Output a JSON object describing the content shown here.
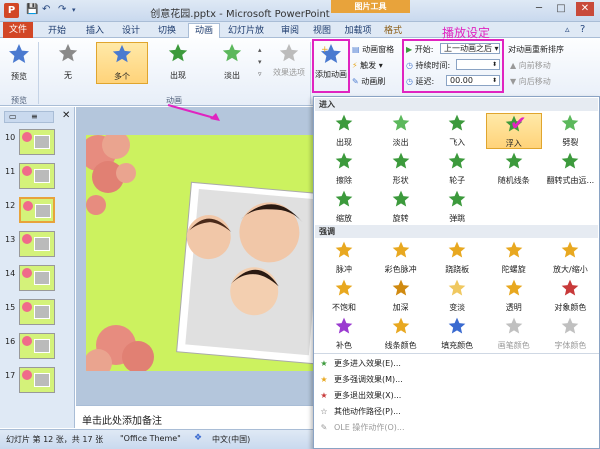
{
  "window": {
    "title": "创意花园.pptx - Microsoft PowerPoint",
    "context_tab_header": "图片工具",
    "app_icon": "P",
    "controls": [
      "─",
      "□",
      "✕"
    ]
  },
  "tabs": [
    {
      "label": "文件",
      "key": "file"
    },
    {
      "label": "开始"
    },
    {
      "label": "插入"
    },
    {
      "label": "设计"
    },
    {
      "label": "切换"
    },
    {
      "label": "动画",
      "key": "active"
    },
    {
      "label": "幻灯片放映"
    },
    {
      "label": "审阅"
    },
    {
      "label": "视图"
    },
    {
      "label": "加载项"
    },
    {
      "label": "格式"
    }
  ],
  "ribbon": {
    "preview_label": "预览",
    "preview_group": "预览",
    "animation_group": "动画",
    "gallery": [
      {
        "label": "无",
        "color": "#8a8a8a"
      },
      {
        "label": "多个",
        "color": "#4a7ad0",
        "selected": true
      },
      {
        "label": "出现",
        "color": "#3c9a3c"
      },
      {
        "label": "淡出",
        "color": "#5cb85c"
      }
    ],
    "effect_options": "效果选项",
    "add_animation": "添加动画",
    "animation_pane": "动画窗格",
    "trigger": "触发",
    "animation_painter": "动画刷",
    "start_label": "开始:",
    "start_value": "上一动画之后",
    "duration_label": "持续时间:",
    "duration_value": "",
    "delay_label": "延迟:",
    "delay_value": "00.00",
    "reorder_title": "对动画重新排序",
    "move_earlier": "向前移动",
    "move_later": "向后移动",
    "annotation": "播放设定"
  },
  "slides_pane": {
    "numbers": [
      "10",
      "11",
      "12",
      "13",
      "14",
      "15",
      "16",
      "17"
    ],
    "selected": "12"
  },
  "notes_placeholder": "单击此处添加备注",
  "status": {
    "slide_info": "幻灯片 第 12 张，共 17 张",
    "theme": "\"Office Theme\"",
    "language": "中文(中国)"
  },
  "dropdown": {
    "entrance_header": "进入",
    "emphasis_header": "强调",
    "entrance": [
      {
        "label": "出现",
        "color": "#3c9a3c"
      },
      {
        "label": "淡出",
        "color": "#5cb85c"
      },
      {
        "label": "飞入",
        "color": "#3c9a3c"
      },
      {
        "label": "浮入",
        "color": "#3c9a3c",
        "selected": true
      },
      {
        "label": "劈裂",
        "color": "#5cb85c"
      },
      {
        "label": "擦除",
        "color": "#3c9a3c"
      },
      {
        "label": "形状",
        "color": "#3c9a3c"
      },
      {
        "label": "轮子",
        "color": "#3c9a3c"
      },
      {
        "label": "随机线条",
        "color": "#3c9a3c"
      },
      {
        "label": "翻转式由远...",
        "color": "#3c9a3c"
      },
      {
        "label": "缩放",
        "color": "#3c9a3c"
      },
      {
        "label": "旋转",
        "color": "#3c9a3c"
      },
      {
        "label": "弹跳",
        "color": "#3c9a3c"
      }
    ],
    "emphasis": [
      {
        "label": "脉冲",
        "color": "#e8a820"
      },
      {
        "label": "彩色脉冲",
        "color": "#e8a820"
      },
      {
        "label": "跷跷板",
        "color": "#e8a820"
      },
      {
        "label": "陀螺旋",
        "color": "#e8a820"
      },
      {
        "label": "放大/缩小",
        "color": "#e8a820"
      },
      {
        "label": "不饱和",
        "color": "#e8a820"
      },
      {
        "label": "加深",
        "color": "#d08a10"
      },
      {
        "label": "变淡",
        "color": "#f0c860"
      },
      {
        "label": "透明",
        "color": "#e8a820"
      },
      {
        "label": "对象颜色",
        "color": "#c83a3a"
      },
      {
        "label": "补色",
        "color": "#9a3ad0"
      },
      {
        "label": "线条颜色",
        "color": "#e8a820"
      },
      {
        "label": "填充颜色",
        "color": "#3a6ad0"
      },
      {
        "label": "画笔颜色",
        "color": "#c0c0c0",
        "dim": true
      },
      {
        "label": "字体颜色",
        "color": "#c0c0c0",
        "dim": true
      }
    ],
    "more": [
      {
        "label": "更多进入效果(E)...",
        "icon": "★",
        "color": "#3c9a3c"
      },
      {
        "label": "更多强调效果(M)...",
        "icon": "★",
        "color": "#e8a820"
      },
      {
        "label": "更多退出效果(X)...",
        "icon": "★",
        "color": "#c83a3a"
      },
      {
        "label": "其他动作路径(P)...",
        "icon": "☆",
        "color": "#666666"
      },
      {
        "label": "OLE 操作动作(O)...",
        "icon": "✎",
        "color": "#999999",
        "dim": true
      }
    ]
  }
}
